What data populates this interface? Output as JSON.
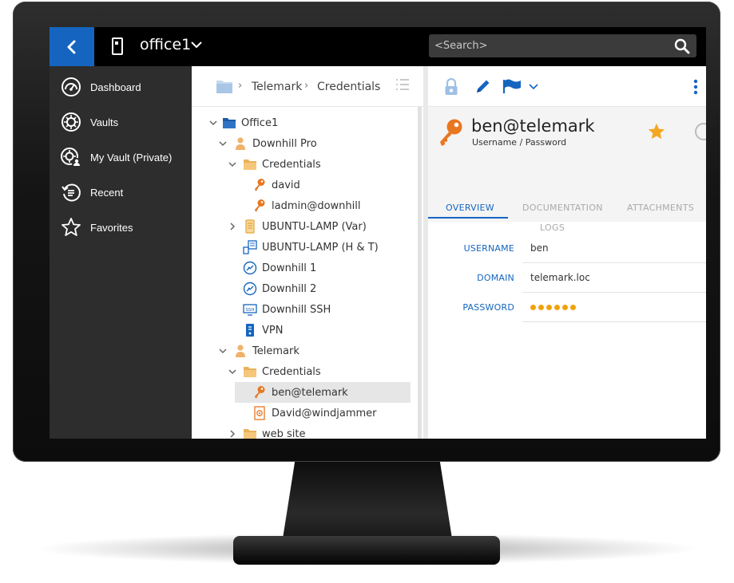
{
  "header": {
    "vault_name": "office1",
    "search_placeholder": "<Search>"
  },
  "sidebar": {
    "items": [
      {
        "label": "Dashboard",
        "icon": "dashboard-icon"
      },
      {
        "label": "Vaults",
        "icon": "vault-icon"
      },
      {
        "label": "My Vault (Private)",
        "icon": "private-vault-icon"
      },
      {
        "label": "Recent",
        "icon": "recent-icon"
      },
      {
        "label": "Favorites",
        "icon": "star-icon"
      }
    ]
  },
  "breadcrumb": {
    "items": [
      "Telemark",
      "Credentials"
    ]
  },
  "tree": {
    "items": [
      {
        "label": "Office1",
        "icon": "folder-blue-icon",
        "expanded": true
      },
      {
        "label": "Downhill Pro",
        "icon": "company-icon",
        "expanded": true
      },
      {
        "label": "Credentials",
        "icon": "folder-icon",
        "expanded": true
      },
      {
        "label": "david",
        "icon": "key-icon"
      },
      {
        "label": "ladmin@downhill",
        "icon": "key-icon"
      },
      {
        "label": "UBUNTU-LAMP (Var)",
        "icon": "server-icon",
        "expanded": false
      },
      {
        "label": "UBUNTU-LAMP (H & T)",
        "icon": "network-icon"
      },
      {
        "label": "Downhill 1",
        "icon": "remote-desktop-icon"
      },
      {
        "label": "Downhill 2",
        "icon": "remote-desktop-icon"
      },
      {
        "label": "Downhill SSH",
        "icon": "ssh-icon"
      },
      {
        "label": "VPN",
        "icon": "vpn-icon"
      },
      {
        "label": "Telemark",
        "icon": "company-icon",
        "expanded": true
      },
      {
        "label": "Credentials",
        "icon": "folder-icon",
        "expanded": true
      },
      {
        "label": "ben@telemark",
        "icon": "key-icon",
        "selected": true
      },
      {
        "label": "David@windjammer",
        "icon": "document-icon"
      },
      {
        "label": "web site",
        "icon": "folder-icon",
        "expanded": false
      }
    ]
  },
  "entry": {
    "title": "ben@telemark",
    "type": "Username / Password",
    "favorite": true,
    "tabs": [
      "OVERVIEW",
      "DOCUMENTATION",
      "ATTACHMENTS",
      "LOGS"
    ],
    "active_tab": "OVERVIEW",
    "fields": [
      {
        "label": "USERNAME",
        "value": "ben"
      },
      {
        "label": "DOMAIN",
        "value": "telemark.loc"
      },
      {
        "label": "PASSWORD",
        "value": "",
        "masked": true
      }
    ]
  },
  "colors": {
    "accent": "#1565c0",
    "key_orange": "#e87722",
    "star": "#f5a623",
    "sidebar_bg": "#2d2d2d"
  }
}
